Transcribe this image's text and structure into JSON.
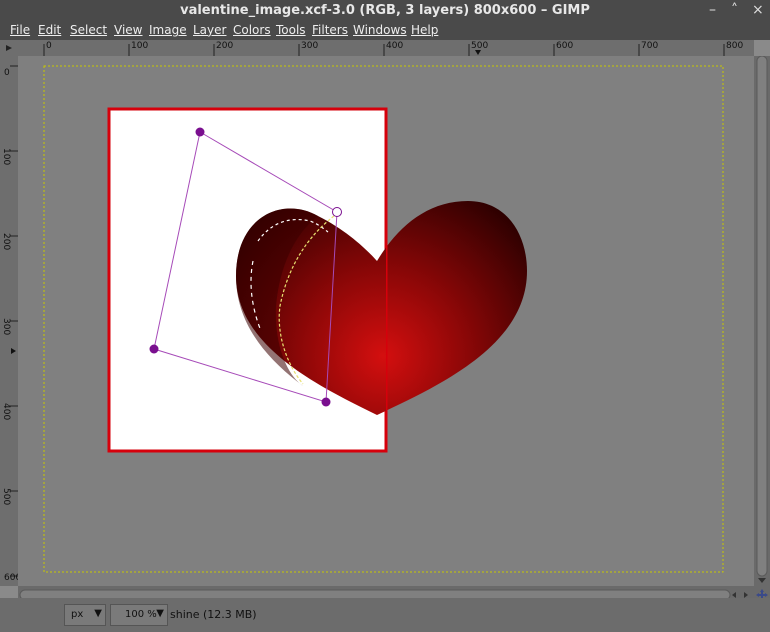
{
  "window": {
    "title": "valentine_image.xcf-3.0 (RGB, 3 layers) 800x600 – GIMP",
    "minimize_icon": "minimize-icon",
    "close_icon": "close-icon"
  },
  "menu": [
    "File",
    "Edit",
    "Select",
    "View",
    "Image",
    "Layer",
    "Colors",
    "Tools",
    "Filters",
    "Windows",
    "Help"
  ],
  "rulers": {
    "top": [
      "0",
      "100",
      "200",
      "300",
      "400",
      "500",
      "600",
      "700",
      "800"
    ],
    "left": [
      "0",
      "100",
      "200",
      "300",
      "400",
      "500",
      "600"
    ]
  },
  "status": {
    "unit": "px",
    "zoom": "100 %",
    "layer_info": "shine (12.3 MB)"
  },
  "colors": {
    "selection_border": "#d6000b",
    "heart_light": "#d40f0f",
    "heart_dark": "#2a0000",
    "handle": "#7a0f8f"
  }
}
